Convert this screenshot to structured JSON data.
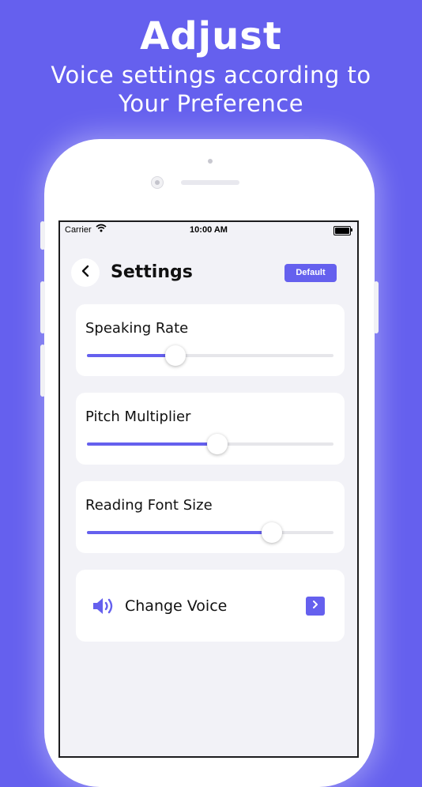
{
  "promo": {
    "headline": "Adjust",
    "subline_1": "Voice settings according to",
    "subline_2": "Your Preference"
  },
  "colors": {
    "accent": "#6560ee",
    "background": "#f2f2f7",
    "card": "#ffffff"
  },
  "status_bar": {
    "carrier": "Carrier",
    "time": "10:00 AM",
    "wifi_icon": "wifi-icon",
    "battery_icon": "battery-icon"
  },
  "header": {
    "back_icon": "chevron-left-icon",
    "title": "Settings",
    "default_label": "Default"
  },
  "sliders": [
    {
      "label": "Speaking Rate",
      "value": 0.36
    },
    {
      "label": "Pitch Multiplier",
      "value": 0.53
    },
    {
      "label": "Reading Font Size",
      "value": 0.75
    }
  ],
  "voice": {
    "icon": "speaker-icon",
    "label": "Change Voice",
    "arrow_icon": "chevron-right-icon"
  }
}
